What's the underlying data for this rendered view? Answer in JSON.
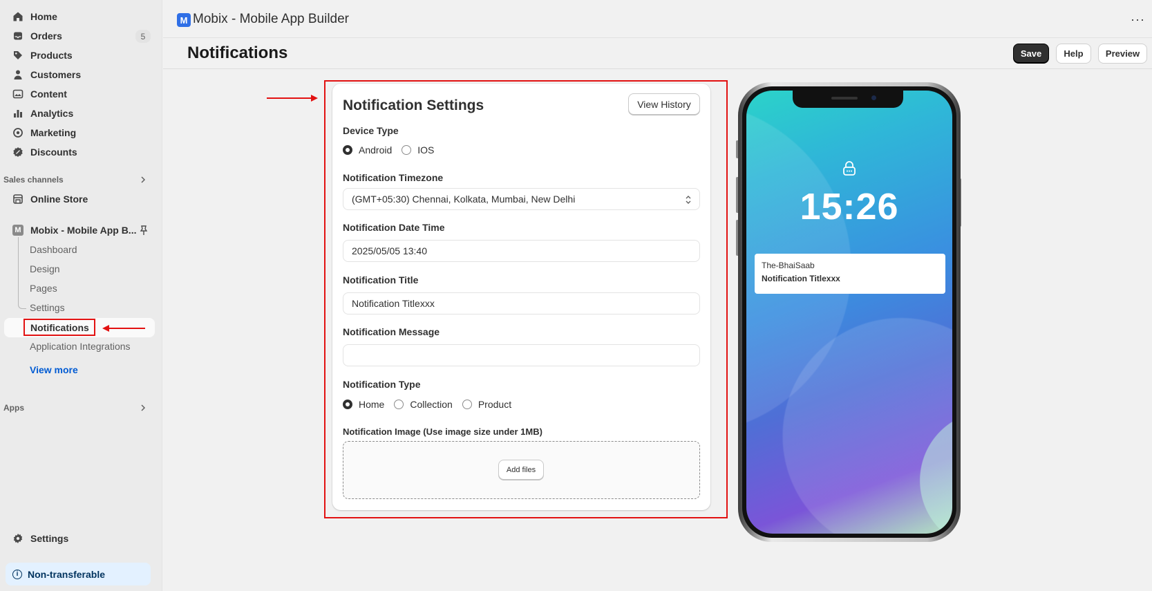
{
  "sidebar": {
    "main_items": [
      {
        "label": "Home",
        "icon": "home-icon"
      },
      {
        "label": "Orders",
        "icon": "inbox-icon",
        "badge": "5"
      },
      {
        "label": "Products",
        "icon": "tag-icon"
      },
      {
        "label": "Customers",
        "icon": "person-icon"
      },
      {
        "label": "Content",
        "icon": "image-icon"
      },
      {
        "label": "Analytics",
        "icon": "bar-chart-icon"
      },
      {
        "label": "Marketing",
        "icon": "target-icon"
      },
      {
        "label": "Discounts",
        "icon": "discount-icon"
      }
    ],
    "sales_channels_label": "Sales channels",
    "online_store_label": "Online Store",
    "app_name": "Mobix - Mobile App B...",
    "app_sub_items": [
      "Dashboard",
      "Design",
      "Pages",
      "Settings",
      "Notifications",
      "Application Integrations"
    ],
    "active_sub_item": "Notifications",
    "view_more_label": "View more",
    "apps_label": "Apps",
    "settings_label": "Settings",
    "non_transferable_label": "Non-transferable"
  },
  "appbar": {
    "title": "Mobix - Mobile App Builder",
    "more_label": "···"
  },
  "page": {
    "title": "Notifications",
    "save_label": "Save",
    "help_label": "Help",
    "preview_label": "Preview"
  },
  "form": {
    "card_title": "Notification Settings",
    "view_history_label": "View History",
    "device_type_label": "Device Type",
    "device_options": [
      "Android",
      "IOS"
    ],
    "device_selected": "Android",
    "timezone_label": "Notification Timezone",
    "timezone_value": "(GMT+05:30) Chennai, Kolkata, Mumbai, New Delhi",
    "datetime_label": "Notification Date Time",
    "datetime_value": "2025/05/05 13:40",
    "title_label": "Notification Title",
    "title_value": "Notification Titlexxx",
    "message_label": "Notification Message",
    "message_value": "",
    "type_label": "Notification Type",
    "type_options": [
      "Home",
      "Collection",
      "Product"
    ],
    "type_selected": "Home",
    "image_label": "Notification Image (Use image size under 1MB)",
    "add_files_label": "Add files"
  },
  "preview": {
    "time": "15:26",
    "notif_app": "The-BhaiSaab",
    "notif_title": "Notification Titlexxx"
  },
  "colors": {
    "accent_red": "#e21111",
    "primary_dark": "#303030",
    "link_blue": "#005bd3"
  }
}
